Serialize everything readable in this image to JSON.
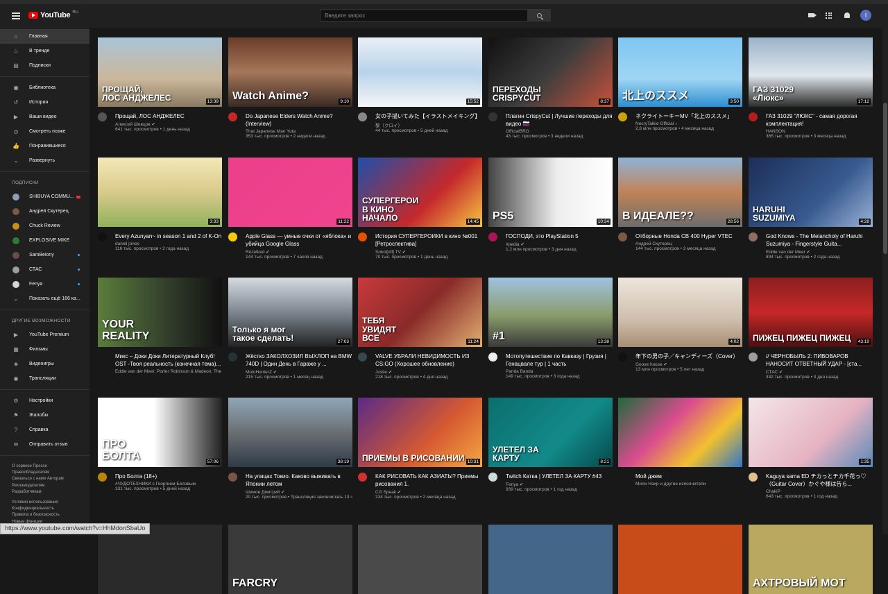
{
  "header": {
    "logo_text": "YouTube",
    "logo_region": "RU",
    "search_placeholder": "Введите запрос",
    "avatar_letter": "I"
  },
  "sidebar": {
    "main": [
      {
        "label": "Главная",
        "icon": "home-icon",
        "active": true
      },
      {
        "label": "В тренде",
        "icon": "fire-icon"
      },
      {
        "label": "Подписки",
        "icon": "subscriptions-icon"
      }
    ],
    "library": [
      {
        "label": "Библиотека",
        "icon": "library-icon"
      },
      {
        "label": "История",
        "icon": "history-icon"
      },
      {
        "label": "Ваши видео",
        "icon": "your-videos-icon"
      },
      {
        "label": "Смотреть позже",
        "icon": "clock-icon"
      },
      {
        "label": "Понравившиеся",
        "icon": "thumb-up-icon"
      },
      {
        "label": "Развернуть",
        "icon": "chevron-down-icon"
      }
    ],
    "subscriptions_heading": "ПОДПИСКИ",
    "subscriptions": [
      {
        "label": "SHIBUYA COMMU...",
        "color": "#8aa0b5",
        "badge": "live"
      },
      {
        "label": "Андрей Скутерец",
        "color": "#7a5a44",
        "badge": ""
      },
      {
        "label": "Chuck Review",
        "color": "#d08a1c",
        "badge": ""
      },
      {
        "label": "EXPLOSIVE MIKE",
        "color": "#2e7d32",
        "badge": ""
      },
      {
        "label": "SamBelony",
        "color": "#6d4c41",
        "badge": "dot"
      },
      {
        "label": "СТАС",
        "color": "#9e9e9e",
        "badge": "dot"
      },
      {
        "label": "Fenya",
        "color": "#cfd8dc",
        "badge": "dot"
      },
      {
        "label": "Показать ещё 166 ка...",
        "color": "",
        "badge": ""
      }
    ],
    "more_heading": "ДРУГИЕ ВОЗМОЖНОСТИ",
    "more": [
      {
        "label": "YouTube Premium",
        "icon": "youtube-premium-icon"
      },
      {
        "label": "Фильмы",
        "icon": "movies-icon"
      },
      {
        "label": "Видеоигры",
        "icon": "gaming-icon"
      },
      {
        "label": "Трансляции",
        "icon": "live-icon"
      }
    ],
    "settings": [
      {
        "label": "Настройки",
        "icon": "gear-icon"
      },
      {
        "label": "Жалобы",
        "icon": "flag-icon"
      },
      {
        "label": "Справка",
        "icon": "help-icon"
      },
      {
        "label": "Отправить отзыв",
        "icon": "feedback-icon"
      }
    ],
    "footer": {
      "line1": "О сервисе  Прессе",
      "line2": "Правообладателям",
      "line3": "Связаться с нами  Авторам",
      "line4": "Рекламодателям",
      "line5": "Разработчикам",
      "line6": "Условия использования",
      "line7": "Конфиденциальность",
      "line8": "Правила и безопасность",
      "line9": "Новые функции"
    }
  },
  "videos": [
    {
      "title": "Прощай, ЛОС АНДЖЕЛЕС",
      "channel": "Алексей Шевцов ✔",
      "stats": "641 тыс. просмотров • 1 день назад",
      "duration": "13:39",
      "thumb_text": "ПРОЩАЙ,\nЛОС АНДЖЕЛЕС",
      "bg": "linear-gradient(180deg,#a9c4d8 0%,#cbb79a 60%,#8a7a60 100%)",
      "av": "#555"
    },
    {
      "title": "Do Japanese Elders Watch Anime? (Interview)",
      "channel": "That Japanese Man Yuta",
      "stats": "353 тыс. просмотров • 2 недели назад",
      "duration": "9:10",
      "thumb_text": "Watch Anime?",
      "bg": "linear-gradient(180deg,#6a3c2a 0%,#a7775a 50%,#3a2a24 100%)",
      "av": "#c62828"
    },
    {
      "title": "女の子描いてみた【イラストメイキング】",
      "channel": "黎（クロイ）",
      "stats": "44 тыс. просмотров • 5 дней назад",
      "duration": "15:52",
      "thumb_text": "",
      "bg": "linear-gradient(180deg,#e9eef5 0%,#b9d3ea 50%,#f5f5f5 100%)",
      "av": "#888"
    },
    {
      "title": "Плагин CrispyCut | Лучшие переходы для видео 🇷🇺",
      "channel": "OfficialBRO",
      "stats": "43 тыс. просмотров • 3 недели назад",
      "duration": "8:37",
      "thumb_text": "ПЕРЕХОДЫ\nCRISPYCUT",
      "bg": "linear-gradient(135deg,#111 0%,#3d3d3d 50%,#c8513a 100%)",
      "av": "#333"
    },
    {
      "title": "ネクライトーキーMV「北上のススメ」",
      "channel": "NecryTalkie Official ♪",
      "stats": "2,8 млн просмотров • 4 месяца назад",
      "duration": "3:50",
      "thumb_text": "北上のススメ",
      "bg": "linear-gradient(180deg,#7fc6f0 0%,#9fd5f4 60%,#2c8fd0 100%)",
      "av": "#caa40c"
    },
    {
      "title": "ГАЗ 31029 \"ЛЮКС\" - самая дорогая комплектация!",
      "channel": "HANSON",
      "stats": "365 тыс. просмотров • 3 месяца назад",
      "duration": "17:12",
      "thumb_text": "ГАЗ 31029\n«Люкс»",
      "bg": "linear-gradient(180deg,#9bb3c9 0%,#dfe6ec 55%,#2b2b2b 100%)",
      "av": "#b71c1c"
    },
    {
      "title": "Every Azunyan~ in season 1 and 2 of K-On",
      "channel": "daniel jones",
      "stats": "116 тыс. просмотров • 2 года назад",
      "duration": "3:33",
      "thumb_text": "",
      "bg": "linear-gradient(180deg,#f3e9b8 0%,#d9c98a 50%,#8fb35c 100%)",
      "av": "#111"
    },
    {
      "title": "Apple Glass — умные очки от «яблока» и убийца Google Glass",
      "channel": "Rozetked ✔",
      "stats": "144 тыс. просмотров • 7 часов назад",
      "duration": "11:22",
      "thumb_text": "",
      "bg": "linear-gradient(135deg,#ec3f8a 0%,#f0448f 100%)",
      "av": "#f6c90e"
    },
    {
      "title": "История СУПЕРГЕРОИКИ в кино №001 [Ретроспектива]",
      "channel": "Sokol[off] TV ✔",
      "stats": "70 тыс. просмотров • 1 день назад",
      "duration": "14:45",
      "thumb_text": "СУПЕРГЕРОИ\nВ КИНО\nНАЧАЛО",
      "bg": "linear-gradient(135deg,#1e4fa8 0%,#c5292b 60%,#f4c542 100%)",
      "av": "#e65100"
    },
    {
      "title": "ГОСПОДИ, это PlayStation 5",
      "channel": "#pedia ✔",
      "stats": "1,2 млн просмотров • 3 дня назад",
      "duration": "10:34",
      "thumb_text": "PS5",
      "bg": "linear-gradient(90deg,#444 0%,#eee 55%,#fff 100%)",
      "av": "#ad1457"
    },
    {
      "title": "Отборные Honda CB 400 Hyper VTEC",
      "channel": "Андрей Скутерец",
      "stats": "144 тыс. просмотров • 3 месяца назад",
      "duration": "28:56",
      "thumb_text": "В ИДЕАЛЕ??",
      "bg": "linear-gradient(180deg,#8fb3d6 0%,#c18357 50%,#6d6d6d 100%)",
      "av": "#7a5a44"
    },
    {
      "title": "God Knows - The Melancholy of Haruhi Suzumiya - Fingerstyle Guita...",
      "channel": "Eddie van der Meer ✔",
      "stats": "894 тыс. просмотров • 2 года назад",
      "duration": "4:28",
      "thumb_text": "HARUHI\nSUZUMIYA",
      "bg": "linear-gradient(135deg,#1c2e57 0%,#375a8f 60%,#9bb1d6 100%)",
      "av": "#8d6e63"
    },
    {
      "title": "Микс – Доки Доки Литературный Клуб! OST -Твоя реальность (конечная тема)...",
      "channel": "Eddie van der Meer, Porter Robinson & Madeon, The Chainsmokers & Coldplay и другие исполнители",
      "stats": "",
      "duration": "",
      "thumb_text": "YOUR\nREALITY",
      "bg": "linear-gradient(90deg,#5a7d3c 0%,#2f3a2a 60%,#111 100%)",
      "av": ""
    },
    {
      "title": "Жёстко ЗАКОЛХОЗИЛ ВЫХЛОП на BMW 740D | Один День в Гараже у ...",
      "channel": "MotoHunterZ ✔",
      "stats": "215 тыс. просмотров • 1 месяц назад",
      "duration": "27:03",
      "thumb_text": "Только я мог\nтакое сделать!",
      "bg": "linear-gradient(180deg,#d6dbe0 0%,#7d8690 50%,#222 100%)",
      "av": "#263238"
    },
    {
      "title": "VALVE УБРАЛИ НЕВИДИМОСТЬ ИЗ CS:GO (Хорошее обновление)",
      "channel": "Justie ✔",
      "stats": "218 тыс. просмотров • 4 дня назад",
      "duration": "11:24",
      "thumb_text": "ТЕБЯ\nУВИДЯТ\nВСЕ",
      "bg": "linear-gradient(135deg,#c93a3a 0%,#8a2a2a 50%,#e0b070 100%)",
      "av": "#37474f"
    },
    {
      "title": "Мотопутешествие по Кавказу | Грузия | Генацвале тур | 1 часть",
      "channel": "Panda Banda",
      "stats": "149 тыс. просмотров • 3 года назад",
      "duration": "13:38",
      "thumb_text": "#1",
      "bg": "linear-gradient(180deg,#9fc2e0 0%,#8a9b6a 55%,#3a3a3a 100%)",
      "av": "#eee"
    },
    {
      "title": "年下の男の子／キャンディーズ（Cover）",
      "channel": "Goose house ✔",
      "stats": "13 млн просмотров • 5 лет назад",
      "duration": "4:02",
      "thumb_text": "",
      "bg": "linear-gradient(180deg,#ede6dc 0%,#cfbfae 60%,#a88d72 100%)",
      "av": "#111"
    },
    {
      "title": "// ЧЕРНОБЫЛЬ 2: ПИВОВАРОВ НАНОСИТ ОТВЕТНЫЙ УДАР - [ста...",
      "channel": "СТАС ✔",
      "stats": "332 тыс. просмотров • 3 дня назад",
      "duration": "43:19",
      "thumb_text": "ПИЖЕЦ ПИЖЕЦ ПИЖЕЦ",
      "bg": "linear-gradient(180deg,#8a1f1f 0%,#c62828 50%,#4a1010 100%)",
      "av": "#9e9e9e"
    },
    {
      "title": "Про Болта (18+)",
      "channel": "#ЧУДОТЕХНИКИ с Георгием Беловым",
      "stats": "331 тыс. просмотров • 5 дней назад",
      "duration": "57:06",
      "thumb_text": "ПРО\nБОЛТА",
      "bg": "linear-gradient(90deg,#fff 0%,#fff 45%,#222 100%)",
      "av": "#b8860b"
    },
    {
      "title": "На улицах Токио. Каково выживать в Японии летом",
      "channel": "Шимов Дмитрий ✔",
      "stats": "20 тыс. просмотров • Трансляция закончилась 13 часов назад",
      "duration": "38:19",
      "thumb_text": "",
      "bg": "linear-gradient(180deg,#8fa7b9 0%,#6b6f73 50%,#2f3a48 100%)",
      "av": "#795548"
    },
    {
      "title": "КАК РИСОВАТЬ КАК АЗИАТЫ? Приемы рисования 1.",
      "channel": "CG Speak ✔",
      "stats": "234 тыс. просмотров • 2 месяца назад",
      "duration": "10:31",
      "thumb_text": "ПРИЕМЫ В РИСОВАНИИ",
      "bg": "linear-gradient(135deg,#5b2a86 0%,#d65a31 60%,#f4a742 100%)",
      "av": "#d32f2f"
    },
    {
      "title": "Twitch Катка | УЛЕТЕЛ ЗА КАРТУ #43",
      "channel": "Fenya ✔",
      "stats": "939 тыс. просмотров • 1 год назад",
      "duration": "8:21",
      "thumb_text": "УЛЕТЕЛ ЗА\nКАРТУ",
      "bg": "linear-gradient(135deg,#0c6e6e 0%,#128a8a 60%,#074848 100%)",
      "av": "#cfd8dc"
    },
    {
      "title": "Мой джем",
      "channel": "Мили Нэир и другие исполнители",
      "stats": "",
      "duration": "",
      "thumb_text": "",
      "bg": "linear-gradient(135deg,#1d6b3a 0%,#d94c8f 40%,#f2c12e 70%,#2f76c9 100%)",
      "av": ""
    },
    {
      "title": "Kaguya sama ED チカっとチカ千花っ♡（Guitar Cover）かぐや様は告ら...",
      "channel": "ChakiP",
      "stats": "643 тыс. просмотров • 1 год назад",
      "duration": "1:35",
      "thumb_text": "",
      "bg": "linear-gradient(135deg,#f4e6e9 0%,#e6b3c3 60%,#5a89b8 100%)",
      "av": "#e0c090"
    },
    {
      "title": "",
      "channel": "",
      "stats": "",
      "duration": "",
      "thumb_text": "",
      "bg": "#2a2a2a",
      "av": ""
    },
    {
      "title": "",
      "channel": "",
      "stats": "",
      "duration": "",
      "thumb_text": "FARCRY",
      "bg": "#3a3a3a",
      "av": ""
    },
    {
      "title": "",
      "channel": "",
      "stats": "",
      "duration": "",
      "thumb_text": "",
      "bg": "#4a4a4a",
      "av": ""
    },
    {
      "title": "",
      "channel": "",
      "stats": "",
      "duration": "",
      "thumb_text": "",
      "bg": "#446688",
      "av": ""
    },
    {
      "title": "",
      "channel": "",
      "stats": "",
      "duration": "",
      "thumb_text": "",
      "bg": "#c84c1a",
      "av": ""
    },
    {
      "title": "",
      "channel": "",
      "stats": "",
      "duration": "",
      "thumb_text": "АХТРОВЫЙ МОТ",
      "bg": "#b8a860",
      "av": ""
    }
  ],
  "status_url": "https://www.youtube.com/watch?v=HhMdonSbaUo"
}
